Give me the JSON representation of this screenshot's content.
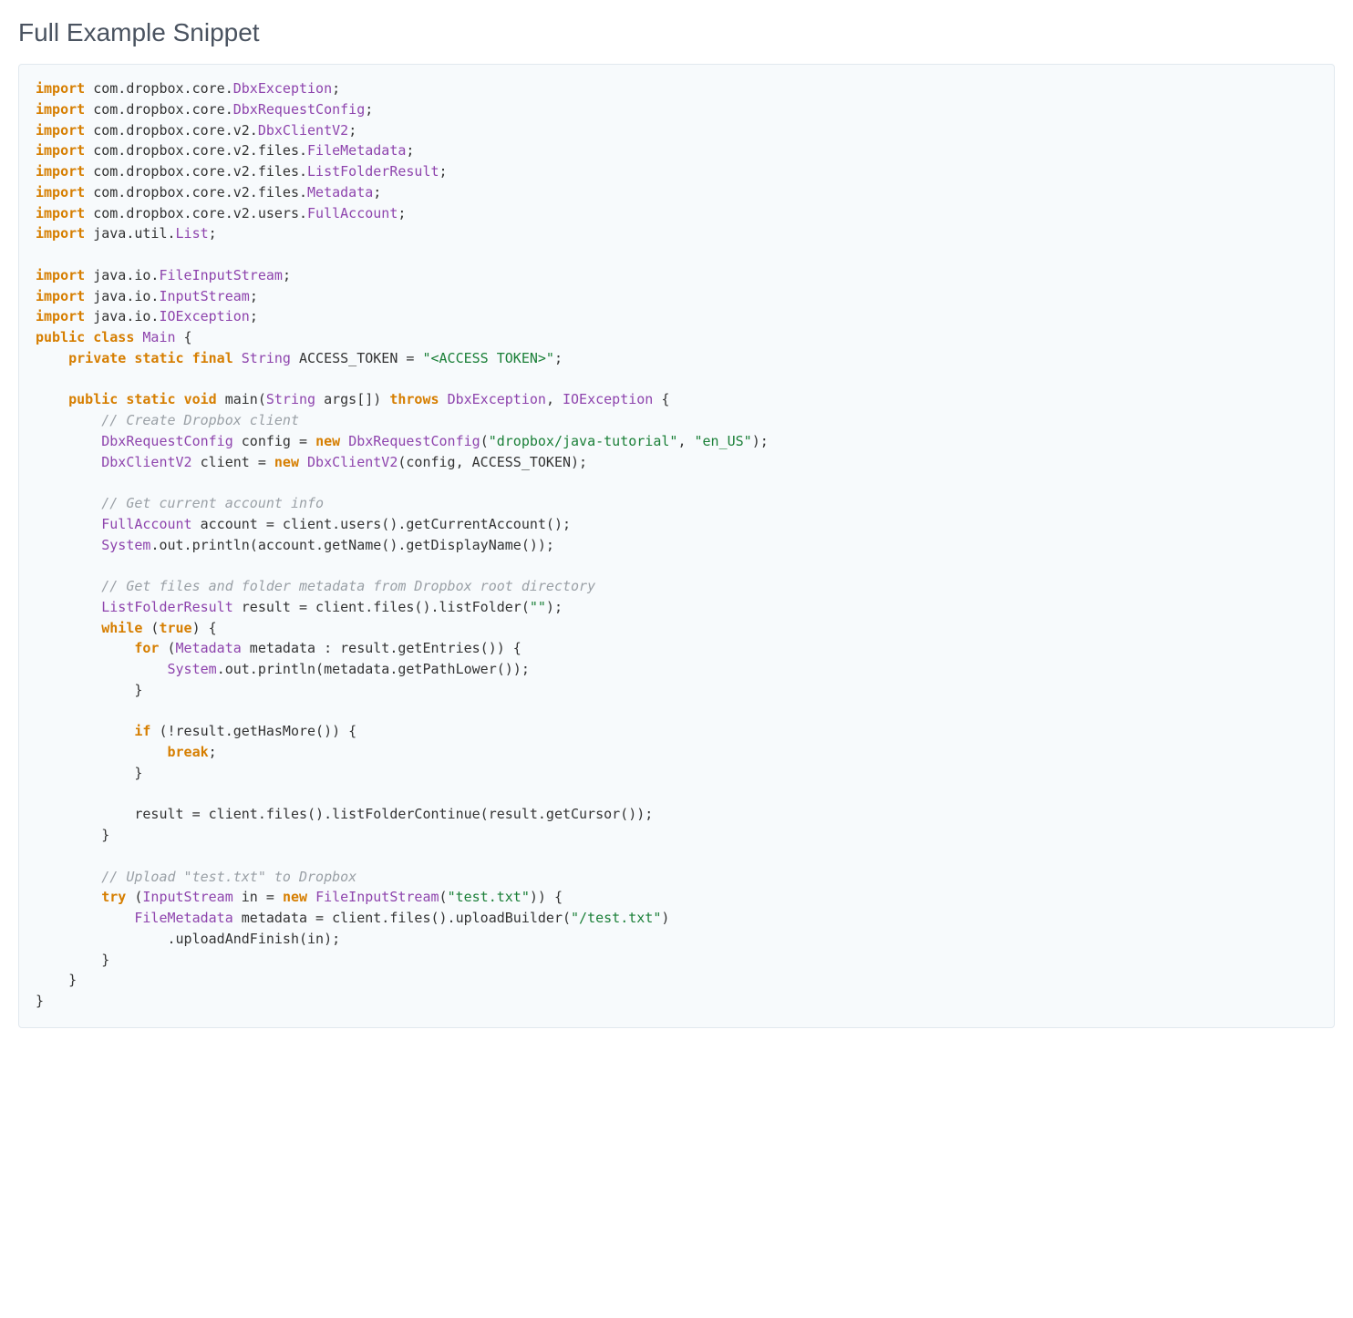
{
  "title": "Full Example Snippet",
  "code": {
    "imports_core": [
      {
        "pkg": "com.dropbox.core.",
        "cls": "DbxException"
      },
      {
        "pkg": "com.dropbox.core.",
        "cls": "DbxRequestConfig"
      },
      {
        "pkg": "com.dropbox.core.v2.",
        "cls": "DbxClientV2"
      },
      {
        "pkg": "com.dropbox.core.v2.files.",
        "cls": "FileMetadata"
      },
      {
        "pkg": "com.dropbox.core.v2.files.",
        "cls": "ListFolderResult"
      },
      {
        "pkg": "com.dropbox.core.v2.files.",
        "cls": "Metadata"
      },
      {
        "pkg": "com.dropbox.core.v2.users.",
        "cls": "FullAccount"
      }
    ],
    "import_util": {
      "pkg": "java.util.",
      "cls": "List"
    },
    "imports_io": [
      {
        "pkg": "java.io.",
        "cls": "FileInputStream"
      },
      {
        "pkg": "java.io.",
        "cls": "InputStream"
      },
      {
        "pkg": "java.io.",
        "cls": "IOException"
      }
    ],
    "kw": {
      "import": "import",
      "public": "public",
      "class": "class",
      "private": "private",
      "static": "static",
      "final": "final",
      "void": "void",
      "throws": "throws",
      "new": "new",
      "while": "while",
      "true": "true",
      "for": "for",
      "if": "if",
      "break": "break",
      "try": "try"
    },
    "types": {
      "Main": "Main",
      "String": "String",
      "DbxException": "DbxException",
      "IOException": "IOException",
      "DbxRequestConfig": "DbxRequestConfig",
      "DbxClientV2": "DbxClientV2",
      "FullAccount": "FullAccount",
      "System": "System",
      "ListFolderResult": "ListFolderResult",
      "Metadata": "Metadata",
      "InputStream": "InputStream",
      "FileInputStream": "FileInputStream",
      "FileMetadata": "FileMetadata"
    },
    "ids": {
      "ACCESS_TOKEN_decl": " ACCESS_TOKEN = ",
      "main_sig_open": " main(",
      "args_decl": " args[]) ",
      "config_assign": " config = ",
      "dbx_cfg_args_open": "(",
      "dbx_cfg_args_sep": ", ",
      "dbx_cfg_close": ");",
      "client_assign": " client = ",
      "client_ctor_args": "(config, ACCESS_TOKEN);",
      "account_assign": " account = client.users().getCurrentAccount();",
      "println_acc": ".out.println(account.getName().getDisplayName());",
      "result_assign": " result = client.files().listFolder(",
      "result_close": ");",
      "while_open": " (",
      "while_close": ") {",
      "for_open": " (",
      "for_var": " metadata : result.getEntries()) {",
      "println_meta": ".out.println(metadata.getPathLower());",
      "if_cond": " (!result.getHasMore()) {",
      "result_cont": "            result = client.files().listFolderContinue(result.getCursor());",
      "try_open": " (",
      "in_assign": " in = ",
      "fis_args_open": "(",
      "fis_close": ")) {",
      "meta_assign": " metadata = client.files().uploadBuilder(",
      "upload_close": ")",
      "upload_finish": "                .uploadAndFinish(in);",
      "brace_open": " {",
      "brace_close": "}",
      "brace_close_i1": "    }",
      "brace_close_i2": "        }",
      "brace_close_i3": "            }",
      "semicolon": ";",
      "space": " "
    },
    "strings": {
      "access_token": "\"<ACCESS TOKEN>\"",
      "dbx_tutorial": "\"dropbox/java-tutorial\"",
      "en_us": "\"en_US\"",
      "empty": "\"\"",
      "test_txt": "\"test.txt\"",
      "slash_test_txt": "\"/test.txt\""
    },
    "comments": {
      "create_client": "// Create Dropbox client",
      "get_account": "// Get current account info",
      "get_files": "// Get files and folder metadata from Dropbox root directory",
      "upload": "// Upload \"test.txt\" to Dropbox"
    }
  }
}
